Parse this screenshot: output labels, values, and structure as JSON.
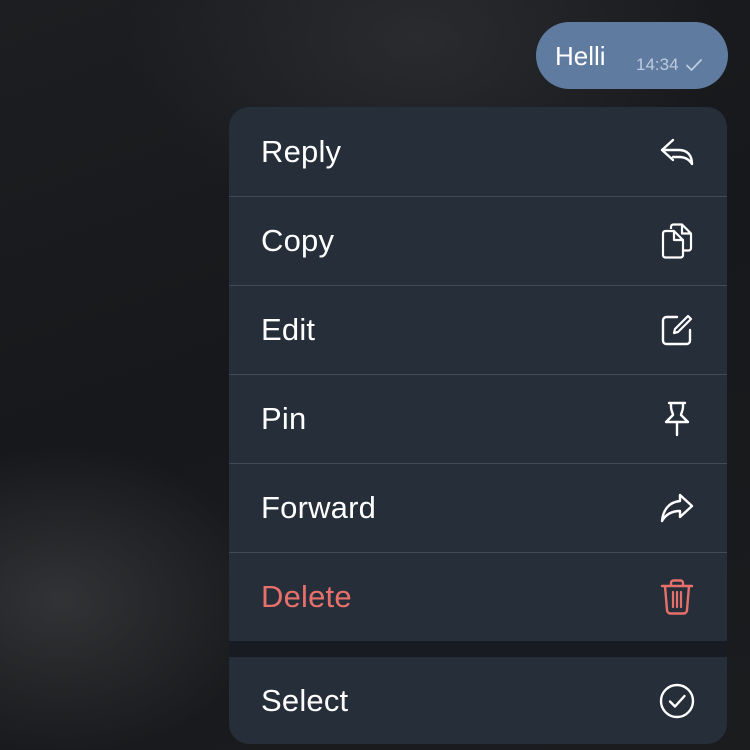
{
  "message": {
    "text": "Helli",
    "time": "14:34",
    "status_icon": "check-icon",
    "bubble_color": "#5f7ca0"
  },
  "menu": {
    "items": [
      {
        "label": "Reply",
        "icon": "reply-icon"
      },
      {
        "label": "Copy",
        "icon": "copy-icon"
      },
      {
        "label": "Edit",
        "icon": "edit-icon"
      },
      {
        "label": "Pin",
        "icon": "pin-icon"
      },
      {
        "label": "Forward",
        "icon": "forward-icon"
      },
      {
        "label": "Delete",
        "icon": "trash-icon",
        "color": "#e8706b"
      }
    ],
    "select": {
      "label": "Select",
      "icon": "check-circle-icon"
    },
    "background_color": "#262e3a"
  }
}
